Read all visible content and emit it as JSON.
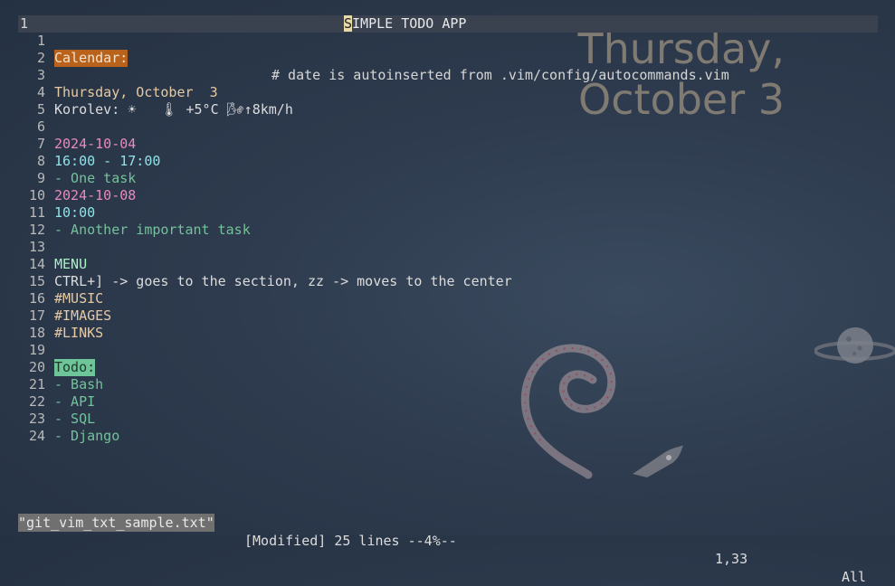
{
  "header": {
    "line_number": "1",
    "title_cursor_char": "S",
    "title_rest": "IMPLE TODO APP"
  },
  "wallpaper": {
    "day": "Thursday,",
    "date": "October 3"
  },
  "lines": [
    {
      "n": "1",
      "text": ""
    },
    {
      "n": "2",
      "text": "Calendar:"
    },
    {
      "n": "3",
      "text": "# date is autoinserted from .vim/config/autocommands.vim"
    },
    {
      "n": "4",
      "text": "Thursday, October  3"
    },
    {
      "n": "5",
      "text": "Korolev: ☀   🌡 +5°C 🌬↑8km/h"
    },
    {
      "n": "6",
      "text": ""
    },
    {
      "n": "7",
      "text": "2024-10-04"
    },
    {
      "n": "8",
      "text": "16:00 - 17:00"
    },
    {
      "n": "9",
      "text": "- One task"
    },
    {
      "n": "10",
      "text": "2024-10-08"
    },
    {
      "n": "11",
      "text": "10:00"
    },
    {
      "n": "12",
      "text": "- Another important task"
    },
    {
      "n": "13",
      "text": ""
    },
    {
      "n": "14",
      "text": "MENU"
    },
    {
      "n": "15",
      "text": "CTRL+] -> goes to the section, zz -> moves to the center"
    },
    {
      "n": "16",
      "text": "#MUSIC"
    },
    {
      "n": "17",
      "text": "#IMAGES"
    },
    {
      "n": "18",
      "text": "#LINKS"
    },
    {
      "n": "19",
      "text": ""
    },
    {
      "n": "20",
      "text": "Todo:"
    },
    {
      "n": "21",
      "text": "- Bash"
    },
    {
      "n": "22",
      "text": "- API"
    },
    {
      "n": "23",
      "text": "- SQL"
    },
    {
      "n": "24",
      "text": "- Django"
    }
  ],
  "status": {
    "filename": "\"git_vim_txt_sample.txt\"",
    "info": "[Modified] 25 lines --4%--",
    "position": "1,33",
    "scroll": "All"
  }
}
